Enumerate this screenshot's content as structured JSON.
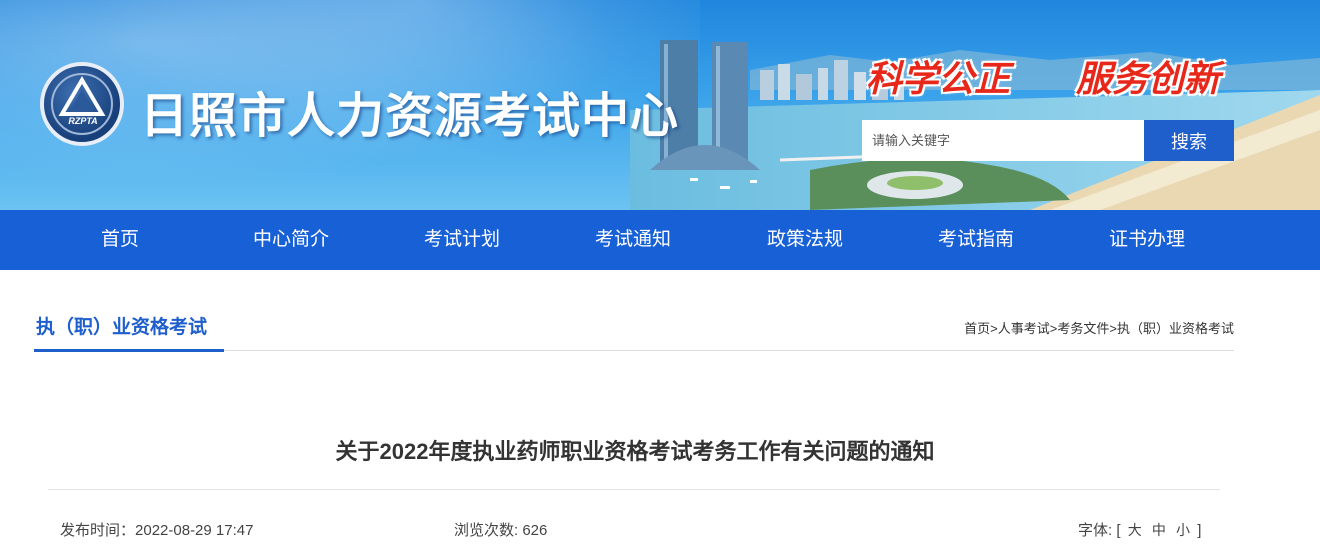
{
  "header": {
    "logo_text": "RZPTA",
    "site_title": "日照市人力资源考试中心",
    "slogan_left": "科学公正",
    "slogan_right": "服务创新",
    "search": {
      "placeholder": "请输入关键字",
      "button_label": "搜索"
    }
  },
  "nav": {
    "items": [
      "首页",
      "中心简介",
      "考试计划",
      "考试通知",
      "政策法规",
      "考试指南",
      "证书办理"
    ]
  },
  "section": {
    "title": "执（职）业资格考试"
  },
  "breadcrumb": {
    "items": [
      "首页",
      "人事考试",
      "考务文件",
      "执（职）业资格考试"
    ],
    "separator": ">"
  },
  "article": {
    "title": "关于2022年度执业药师职业资格考试考务工作有关问题的通知",
    "date_label": "发布时间：",
    "date": "2022-08-29 17:47",
    "views_label": "浏览次数:",
    "views": "626",
    "font_label": "字体:",
    "font_open": "[",
    "font_large": "大",
    "font_medium": "中",
    "font_small": "小",
    "font_close": "]"
  },
  "colors": {
    "nav_bg": "#1860d6",
    "accent": "#1f5fcc",
    "slogan": "#e8271b"
  }
}
